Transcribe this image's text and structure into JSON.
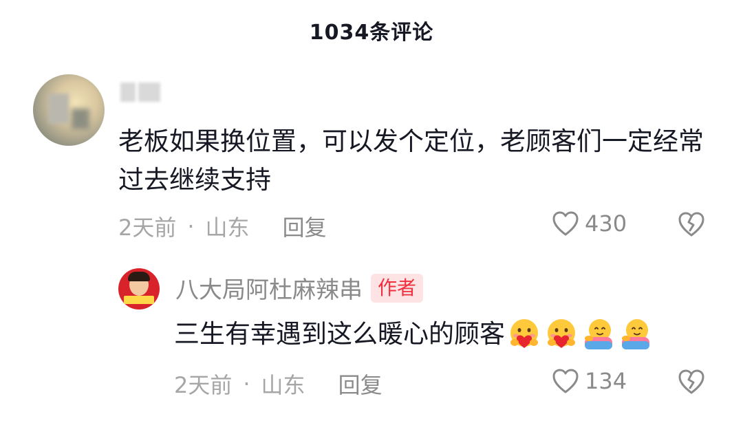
{
  "header": {
    "title": "1034条评论"
  },
  "comment": {
    "avatar_icon": "blurred-user-avatar",
    "username_blurred": true,
    "text": "老板如果换位置，可以发个定位，老顾客们一定经常过去继续支持",
    "time": "2天前",
    "separator": "·",
    "location": "山东",
    "reply_label": "回复",
    "like_count": "430"
  },
  "reply": {
    "avatar_icon": "shop-logo-avatar",
    "name": "八大局阿杜麻辣串",
    "badge": "作者",
    "text": "三生有幸遇到这么暖心的顾客",
    "emojis": [
      "heart-hug-emoji",
      "heart-hug-emoji",
      "hug-emoji",
      "hug-emoji"
    ],
    "time": "2天前",
    "separator": "·",
    "location": "山东",
    "reply_label": "回复",
    "like_count": "134"
  },
  "colors": {
    "text_primary": "#161823",
    "text_secondary": "#a6a6a6",
    "badge_bg": "#fde3e4",
    "badge_text": "#f0303e"
  }
}
